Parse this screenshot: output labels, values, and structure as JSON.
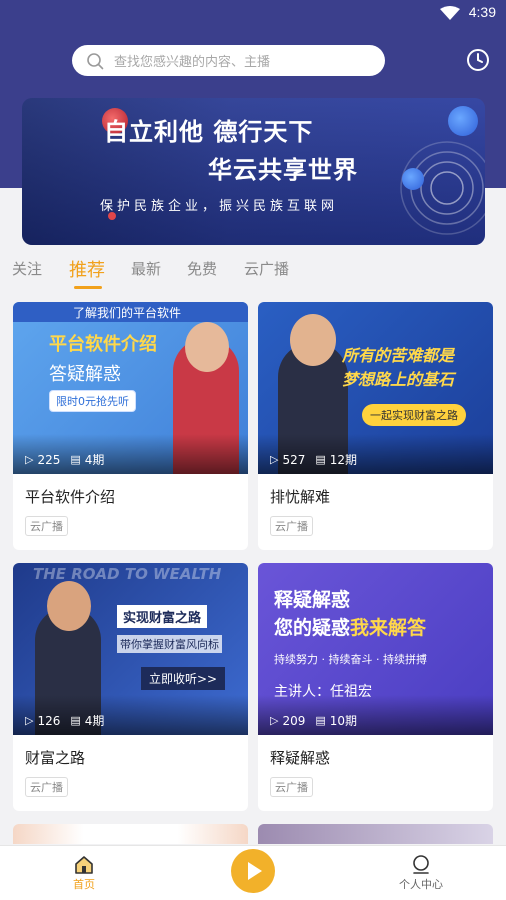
{
  "status_bar": {
    "time": "4:39"
  },
  "search": {
    "placeholder": "查找您感兴趣的内容、主播"
  },
  "banner": {
    "line1": "自立利他 德行天下",
    "line2": "华云共享世界",
    "line3": "保护民族企业，振兴民族互联网"
  },
  "tabs": [
    {
      "label": "关注"
    },
    {
      "label": "推荐"
    },
    {
      "label": "最新"
    },
    {
      "label": "免费"
    },
    {
      "label": "云广播"
    }
  ],
  "active_tab": "推荐",
  "cards": [
    {
      "title": "平台软件介绍",
      "tag": "云广播",
      "plays": "225",
      "episodes": "4期",
      "thumb": {
        "top": "了解我们的平台软件",
        "big": "平台软件介绍",
        "sub": "答疑解惑",
        "badge": "限时0元抢先听"
      }
    },
    {
      "title": "排忧解难",
      "tag": "云广播",
      "plays": "527",
      "episodes": "12期",
      "thumb": {
        "line1": "所有的苦难都是",
        "line2": "梦想路上的基石",
        "badge": "一起实现财富之路"
      }
    },
    {
      "title": "财富之路",
      "tag": "云广播",
      "plays": "126",
      "episodes": "4期",
      "thumb": {
        "bg_text": "THE ROAD TO WEALTH",
        "box": "实现财富之路",
        "sub": "带你掌握财富风向标",
        "btn": "立即收听>>"
      }
    },
    {
      "title": "释疑解惑",
      "tag": "云广播",
      "plays": "209",
      "episodes": "10期",
      "thumb": {
        "line1": "释疑解惑",
        "line2a": "您的疑惑",
        "line2b": "我来解答",
        "line3": "持续努力 · 持续奋斗 · 持续拼搏",
        "speaker": "主讲人：任祖宏"
      }
    }
  ],
  "bottom_nav": {
    "home": "首页",
    "profile": "个人中心"
  },
  "colors": {
    "accent": "#f1a11c",
    "header": "#3b3f8c"
  }
}
